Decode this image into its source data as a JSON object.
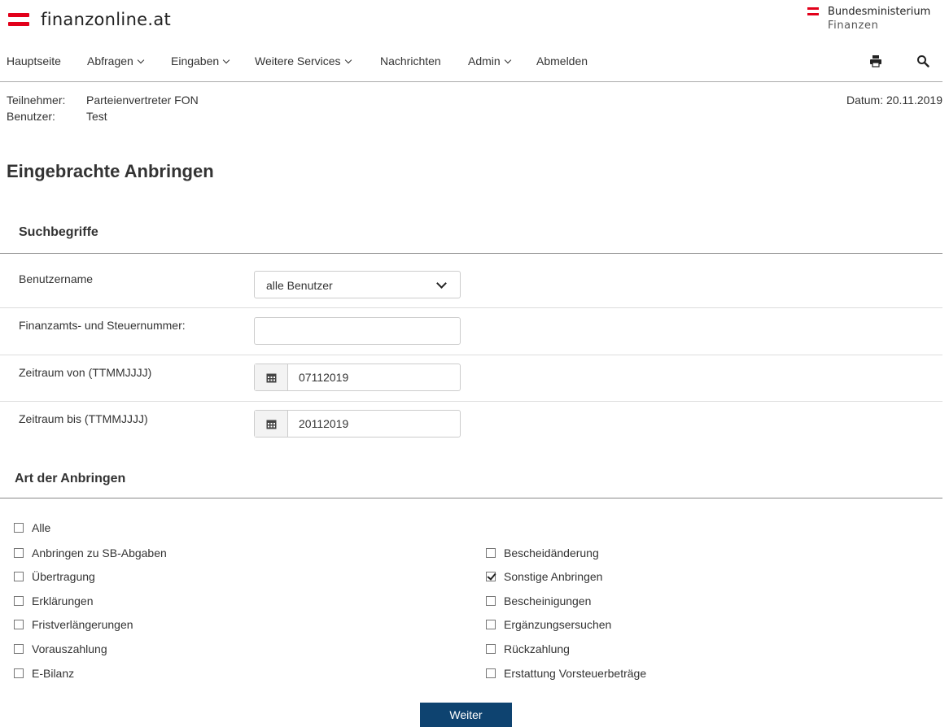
{
  "header": {
    "logo_text": "finanzonline.at",
    "ministry_line1": "Bundesministerium",
    "ministry_line2": "Finanzen"
  },
  "nav": {
    "items": [
      {
        "label": "Hauptseite"
      },
      {
        "label": "Abfragen"
      },
      {
        "label": "Eingaben"
      },
      {
        "label": "Weitere Services"
      },
      {
        "label": "Nachrichten"
      },
      {
        "label": "Admin"
      },
      {
        "label": "Abmelden"
      }
    ],
    "icons": [
      "print-icon",
      "search-icon"
    ]
  },
  "info": {
    "participant_label": "Teilnehmer:",
    "participant_value": "Parteienvertreter FON",
    "user_label": "Benutzer:",
    "user_value": "Test",
    "date_text": "Datum: 20.11.2019"
  },
  "page_title": "Eingebrachte Anbringen",
  "search": {
    "heading": "Suchbegriffe",
    "username_label": "Benutzername",
    "username_value": "alle Benutzer",
    "taxnumber_label": "Finanzamts- und Steuernummer:",
    "taxnumber_value": "",
    "from_label": "Zeitraum von (TTMMJJJJ)",
    "from_value": "07112019",
    "to_label": "Zeitraum bis (TTMMJJJJ)",
    "to_value": "20112019"
  },
  "types": {
    "heading": "Art der Anbringen",
    "all": {
      "label": "Alle",
      "checked": false
    },
    "left": [
      {
        "label": "Anbringen zu SB-Abgaben",
        "checked": false
      },
      {
        "label": "Übertragung",
        "checked": false
      },
      {
        "label": "Erklärungen",
        "checked": false
      },
      {
        "label": "Fristverlängerungen",
        "checked": false
      },
      {
        "label": "Vorauszahlung",
        "checked": false
      },
      {
        "label": "E-Bilanz",
        "checked": false
      }
    ],
    "right": [
      {
        "label": "Bescheidänderung",
        "checked": false
      },
      {
        "label": "Sonstige Anbringen",
        "checked": true
      },
      {
        "label": "Bescheinigungen",
        "checked": false
      },
      {
        "label": "Ergänzungsersuchen",
        "checked": false
      },
      {
        "label": "Rückzahlung",
        "checked": false
      },
      {
        "label": "Erstattung Vorsteuerbeträge",
        "checked": false
      }
    ]
  },
  "submit_label": "Weiter",
  "colors": {
    "brand_red": "#e2001a",
    "button_blue": "#0e4370"
  }
}
